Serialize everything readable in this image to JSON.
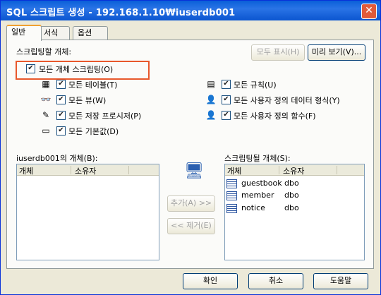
{
  "window": {
    "title": "SQL 스크립트 생성 - 192.168.1.10₩iuserdb001"
  },
  "tabs": [
    {
      "label": "일반"
    },
    {
      "label": "서식"
    },
    {
      "label": "옵션"
    }
  ],
  "objects_label": "스크립팅할 개체:",
  "show_all_button": "모두 표시(H)",
  "preview_button": "미리 보기(V)...",
  "script_all": {
    "label": "모든 개체 스크립팅(O)",
    "checked": true
  },
  "options_left": [
    {
      "label": "모든 테이블(T)",
      "icon": "table-icon"
    },
    {
      "label": "모든 뷰(W)",
      "icon": "view-icon"
    },
    {
      "label": "모든 저장 프로시저(P)",
      "icon": "stored-procedure-icon"
    },
    {
      "label": "모든 기본값(D)",
      "icon": "default-icon"
    }
  ],
  "options_right": [
    {
      "label": "모든 규칙(U)",
      "icon": "rule-icon"
    },
    {
      "label": "모든 사용자 정의 데이터 형식(Y)",
      "icon": "user-datatype-icon"
    },
    {
      "label": "모든 사용자 정의 함수(F)",
      "icon": "user-function-icon"
    }
  ],
  "source_list": {
    "label": "iuserdb001의 개체(B):",
    "columns": [
      "개체",
      "소유자"
    ],
    "rows": []
  },
  "add_button": "추가(A) >>",
  "remove_button": "<< 제거(E)",
  "target_list": {
    "label": "스크립팅될 개체(S):",
    "columns": [
      "개체",
      "소유자"
    ],
    "rows": [
      {
        "name": "guestbook",
        "owner": "dbo"
      },
      {
        "name": "member",
        "owner": "dbo"
      },
      {
        "name": "notice",
        "owner": "dbo"
      }
    ]
  },
  "footer": {
    "ok": "확인",
    "cancel": "취소",
    "help": "도움말"
  }
}
